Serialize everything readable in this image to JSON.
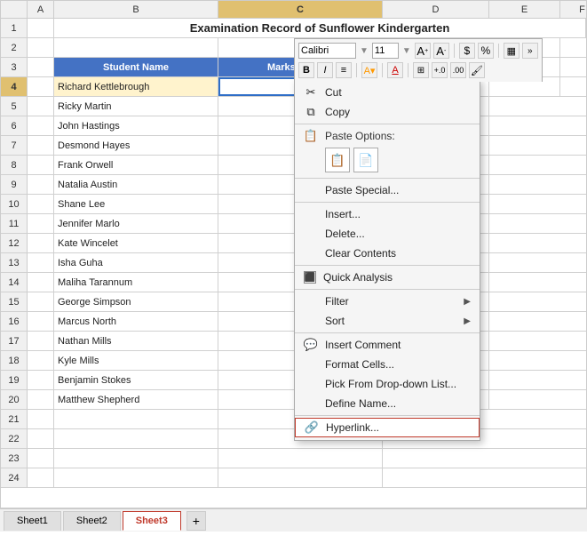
{
  "title": "Examination Record of Sunflower Kindergarten",
  "columns": {
    "a": {
      "label": "A",
      "width": 30
    },
    "b": {
      "label": "B",
      "width": 185
    },
    "c": {
      "label": "C",
      "width": 185,
      "active": true
    },
    "d": {
      "label": "D",
      "width": 120
    },
    "e": {
      "label": "E",
      "width": 80
    },
    "f": {
      "label": "F",
      "width": 50
    }
  },
  "toolbar": {
    "font_name": "Calibri",
    "font_size": "11",
    "bold": "B",
    "italic": "I",
    "align": "≡",
    "font_color_label": "A",
    "percent": "%",
    "dollar": "$",
    "comma": ",",
    "dec_increase": ".0",
    "dec_decrease": ".00"
  },
  "headers": {
    "student_name": "Student Name",
    "marks": "Marks in Phys"
  },
  "students": [
    {
      "row": 4,
      "name": "Richard Kettlebrough"
    },
    {
      "row": 5,
      "name": "Ricky Martin"
    },
    {
      "row": 6,
      "name": "John Hastings"
    },
    {
      "row": 7,
      "name": "Desmond Hayes"
    },
    {
      "row": 8,
      "name": "Frank Orwell"
    },
    {
      "row": 9,
      "name": "Natalia Austin"
    },
    {
      "row": 10,
      "name": "Shane Lee"
    },
    {
      "row": 11,
      "name": "Jennifer Marlo"
    },
    {
      "row": 12,
      "name": "Kate Wincelet"
    },
    {
      "row": 13,
      "name": "Isha Guha"
    },
    {
      "row": 14,
      "name": "Maliha Tarannum"
    },
    {
      "row": 15,
      "name": "George Simpson"
    },
    {
      "row": 16,
      "name": "Marcus North"
    },
    {
      "row": 17,
      "name": "Nathan Mills"
    },
    {
      "row": 18,
      "name": "Kyle Mills"
    },
    {
      "row": 19,
      "name": "Benjamin Stokes"
    },
    {
      "row": 20,
      "name": "Matthew Shepherd"
    }
  ],
  "context_menu": {
    "items": [
      {
        "id": "cut",
        "label": "Cut",
        "icon": "✂",
        "has_arrow": false
      },
      {
        "id": "copy",
        "label": "Copy",
        "icon": "⧉",
        "has_arrow": false
      },
      {
        "id": "paste-options-header",
        "label": "Paste Options:",
        "icon": "📋",
        "has_arrow": false
      },
      {
        "id": "paste-special",
        "label": "Paste Special...",
        "icon": "",
        "has_arrow": false
      },
      {
        "id": "insert",
        "label": "Insert...",
        "icon": "",
        "has_arrow": false
      },
      {
        "id": "delete",
        "label": "Delete...",
        "icon": "",
        "has_arrow": false
      },
      {
        "id": "clear-contents",
        "label": "Clear Contents",
        "icon": "",
        "has_arrow": false
      },
      {
        "id": "quick-analysis",
        "label": "Quick Analysis",
        "icon": "⬛",
        "has_arrow": false
      },
      {
        "id": "filter",
        "label": "Filter",
        "icon": "",
        "has_arrow": true
      },
      {
        "id": "sort",
        "label": "Sort",
        "icon": "",
        "has_arrow": true
      },
      {
        "id": "insert-comment",
        "label": "Insert Comment",
        "icon": "💬",
        "has_arrow": false
      },
      {
        "id": "format-cells",
        "label": "Format Cells...",
        "icon": "",
        "has_arrow": false
      },
      {
        "id": "pick-dropdown",
        "label": "Pick From Drop-down List...",
        "icon": "",
        "has_arrow": false
      },
      {
        "id": "define-name",
        "label": "Define Name...",
        "icon": "",
        "has_arrow": false
      },
      {
        "id": "hyperlink",
        "label": "Hyperlink...",
        "icon": "🔗",
        "has_arrow": false
      }
    ]
  },
  "sheets": [
    {
      "id": "sheet1",
      "label": "Sheet1",
      "active": false
    },
    {
      "id": "sheet2",
      "label": "Sheet2",
      "active": false
    },
    {
      "id": "sheet3",
      "label": "Sheet3",
      "active": true
    }
  ]
}
